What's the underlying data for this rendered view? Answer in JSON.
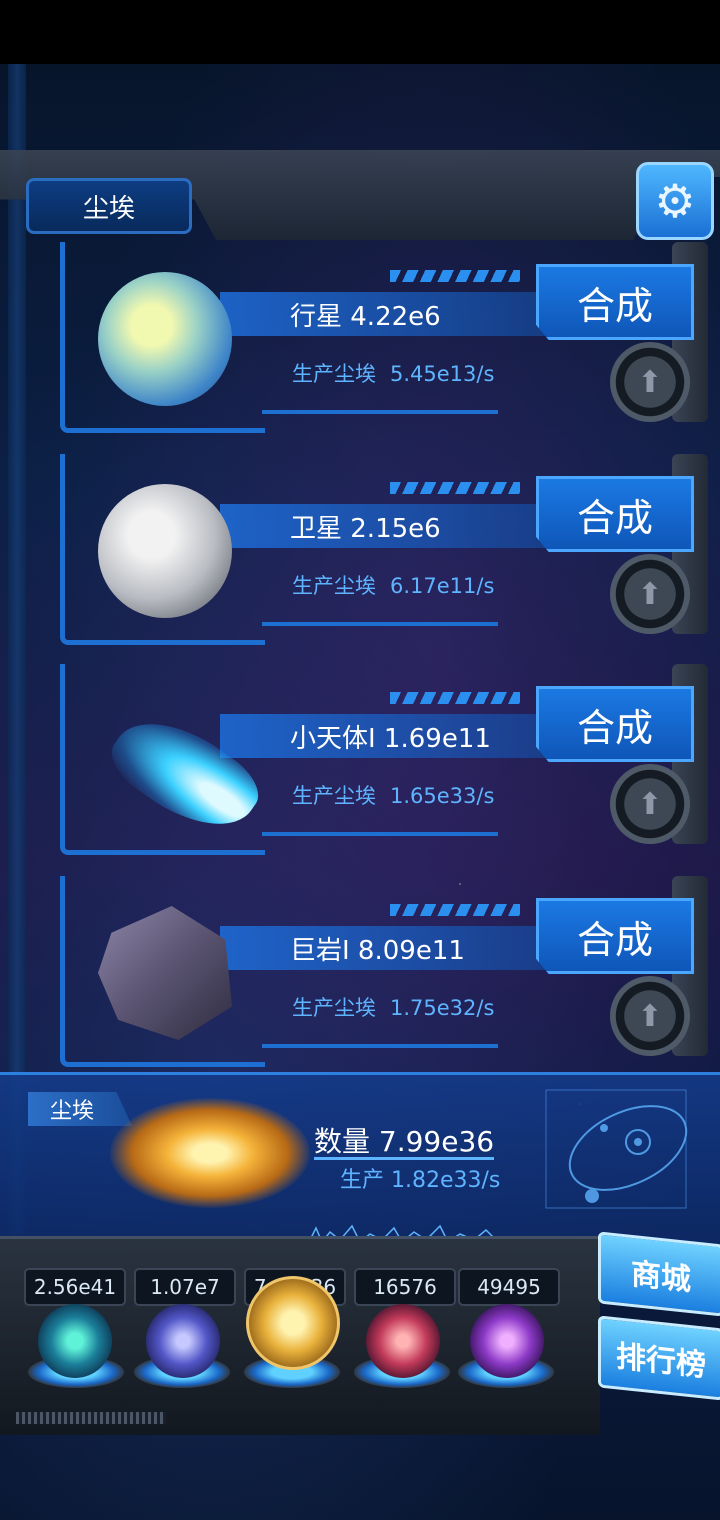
{
  "header": {
    "title": "尘埃"
  },
  "rows": [
    {
      "name": "行星 4.22e6",
      "prod_label": "生产尘埃",
      "prod_value": "5.45e13/s",
      "action": "合成"
    },
    {
      "name": "卫星 2.15e6",
      "prod_label": "生产尘埃",
      "prod_value": "6.17e11/s",
      "action": "合成"
    },
    {
      "name": "小天体I 1.69e11",
      "prod_label": "生产尘埃",
      "prod_value": "1.65e33/s",
      "action": "合成"
    },
    {
      "name": "巨岩I 8.09e11",
      "prod_label": "生产尘埃",
      "prod_value": "1.75e32/s",
      "action": "合成"
    }
  ],
  "dust": {
    "tag": "尘埃",
    "count": "数量 7.99e36",
    "rate": "生产 1.82e33/s"
  },
  "resources": [
    "2.56e41",
    "1.07e7",
    "7.99e36",
    "16576",
    "49495"
  ],
  "side_buttons": {
    "shop": "商城",
    "rank": "排行榜"
  },
  "icons": {
    "settings": "gear-icon",
    "upgrade": "up-arrow-icon"
  },
  "colors": {
    "accent": "#1b79e3",
    "text_blue": "#5fb4ff"
  }
}
